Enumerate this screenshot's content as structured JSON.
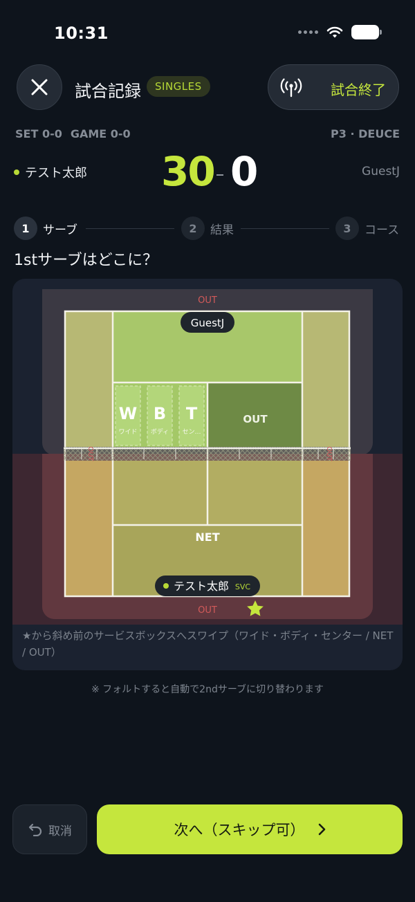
{
  "status_bar": {
    "time": "10:31"
  },
  "header": {
    "title": "試合記録",
    "mode_badge": "SINGLES",
    "end_match_label": "試合終了"
  },
  "score": {
    "set": "SET 0-0",
    "game": "GAME 0-0",
    "point_status": "P3 · DEUCE",
    "server_name": "テスト太郎",
    "opponent_name": "GuestJ",
    "server_points": "30",
    "opponent_points": "0"
  },
  "steps": [
    {
      "num": "1",
      "label": "サーブ",
      "active": true
    },
    {
      "num": "2",
      "label": "結果",
      "active": false
    },
    {
      "num": "3",
      "label": "コース",
      "active": false
    }
  ],
  "question": "1stサーブはどこに？",
  "court": {
    "out_label_top": "OUT",
    "out_label_bottom": "OUT",
    "side_out_label": "OUT",
    "opponent_chip": "GuestJ",
    "server_chip": "テスト太郎",
    "server_tag": "SVC",
    "zones": [
      {
        "letter": "W",
        "label": "ワイド"
      },
      {
        "letter": "B",
        "label": "ボディ"
      },
      {
        "letter": "T",
        "label": "セン…"
      }
    ],
    "out_box_label": "OUT",
    "net_label": "NET",
    "accent_color": "#c5e63d"
  },
  "hint_text": "★から斜め前のサービスボックスへスワイプ（ワイド・ボディ・センター / NET / OUT）",
  "note_text": "※ フォルトすると自動で2ndサーブに切り替わります",
  "buttons": {
    "cancel_label": "取消",
    "next_label": "次へ（スキップ可）"
  }
}
